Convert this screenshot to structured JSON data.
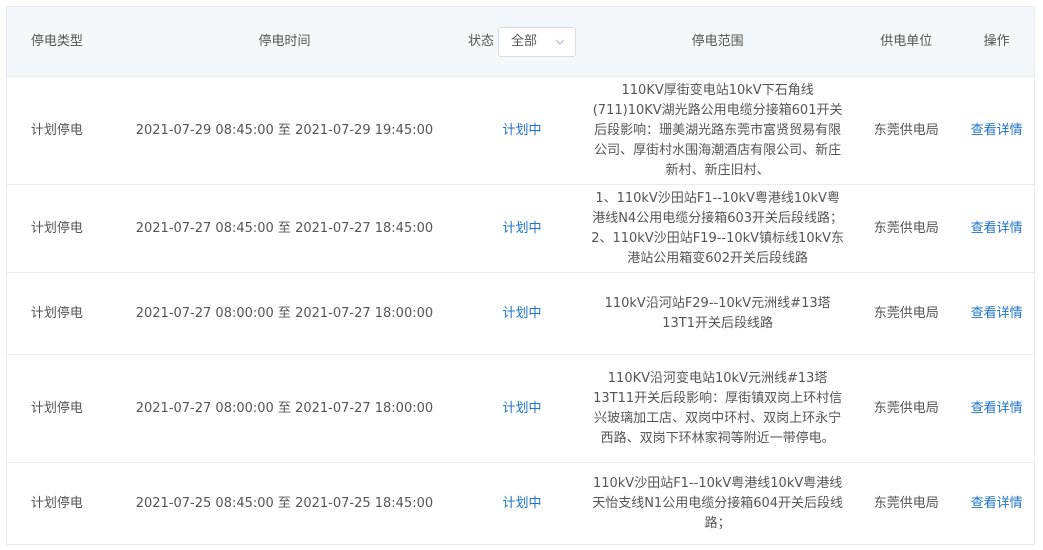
{
  "header": {
    "type": "停电类型",
    "time": "停电时间",
    "status_label": "状态",
    "status_select": "全部",
    "range": "停电范围",
    "unit": "供电单位",
    "op": "操作"
  },
  "rows": [
    {
      "type": "计划停电",
      "time": "2021-07-29 08:45:00 至 2021-07-29 19:45:00",
      "status": "计划中",
      "range": "110KV厚街变电站10kV下石角线(711)10KV湖光路公用电缆分接箱601开关后段影响：珊美湖光路东莞市富贤贸易有限公司、厚街村水围海潮酒店有限公司、新庄新村、新庄旧村、",
      "unit": "东莞供电局",
      "op": "查看详情"
    },
    {
      "type": "计划停电",
      "time": "2021-07-27 08:45:00 至 2021-07-27 18:45:00",
      "status": "计划中",
      "range": "1、110kV沙田站F1--10kV粤港线10kV粤港线N4公用电缆分接箱603开关后段线路；2、110kV沙田站F19--10kV镇标线10kV东港站公用箱变602开关后段线路",
      "unit": "东莞供电局",
      "op": "查看详情"
    },
    {
      "type": "计划停电",
      "time": "2021-07-27 08:00:00 至 2021-07-27 18:00:00",
      "status": "计划中",
      "range": "110kV沿河站F29--10kV元洲线#13塔13T1开关后段线路",
      "unit": "东莞供电局",
      "op": "查看详情"
    },
    {
      "type": "计划停电",
      "time": "2021-07-27 08:00:00 至 2021-07-27 18:00:00",
      "status": "计划中",
      "range": "110KV沿河变电站10kV元洲线#13塔13T11开关后段影响：厚街镇双岗上环村信兴玻璃加工店、双岗中环村、双岗上环永宁西路、双岗下环林家祠等附近一带停电。",
      "unit": "东莞供电局",
      "op": "查看详情"
    },
    {
      "type": "计划停电",
      "time": "2021-07-25 08:45:00 至 2021-07-25 18:45:00",
      "status": "计划中",
      "range": "110kV沙田站F1--10kV粤港线10kV粤港线天怡支线N1公用电缆分接箱604开关后段线路；",
      "unit": "东莞供电局",
      "op": "查看详情"
    }
  ]
}
